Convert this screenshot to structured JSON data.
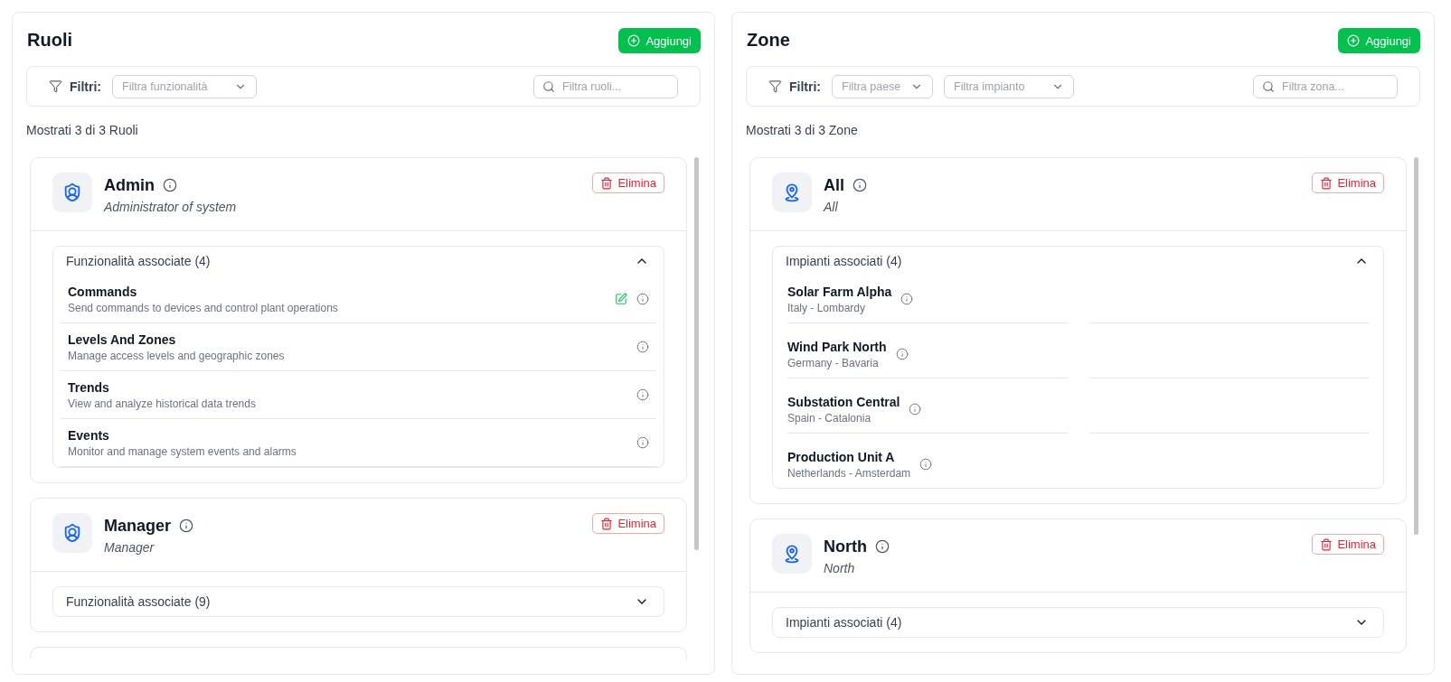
{
  "panels": [
    {
      "title": "Ruoli",
      "add_button": "Aggiungi",
      "filters": {
        "label": "Filtri:",
        "selects": [
          {
            "placeholder": "Filtra funzionalità"
          }
        ],
        "search": {
          "placeholder": "Filtra ruoli..."
        }
      },
      "summary": "Mostrati 3 di 3 Ruoli",
      "cards": [
        {
          "kind": "role",
          "name": "Admin",
          "description": "Administrator of system",
          "delete_button": "Elimina",
          "section": {
            "title": "Funzionalità associate (4)",
            "expanded": true,
            "kind": "list",
            "items": [
              {
                "title": "Commands",
                "subtitle": "Send commands to devices and control plant operations",
                "editable": true
              },
              {
                "title": "Levels And Zones",
                "subtitle": "Manage access levels and geographic zones",
                "editable": false
              },
              {
                "title": "Trends",
                "subtitle": "View and analyze historical data trends",
                "editable": false
              },
              {
                "title": "Events",
                "subtitle": "Monitor and manage system events and alarms",
                "editable": false
              }
            ]
          }
        },
        {
          "kind": "role",
          "name": "Manager",
          "description": "Manager",
          "delete_button": "Elimina",
          "section": {
            "title": "Funzionalità associate (9)",
            "expanded": false
          }
        },
        {
          "kind": "role"
        }
      ]
    },
    {
      "title": "Zone",
      "add_button": "Aggiungi",
      "filters": {
        "label": "Filtri:",
        "selects": [
          {
            "placeholder": "Filtra paese"
          },
          {
            "placeholder": "Filtra impianto"
          }
        ],
        "search": {
          "placeholder": "Filtra zona..."
        }
      },
      "summary": "Mostrati 3 di 3 Zone",
      "cards": [
        {
          "kind": "zone",
          "name": "All",
          "description": "All",
          "delete_button": "Elimina",
          "section": {
            "title": "Impianti associati (4)",
            "expanded": true,
            "kind": "grid",
            "items": [
              {
                "title": "Solar Farm Alpha",
                "subtitle": "Italy - Lombardy"
              },
              {
                "title": "Wind Park North",
                "subtitle": "Germany - Bavaria"
              },
              {
                "title": "Substation Central",
                "subtitle": "Spain - Catalonia"
              },
              {
                "title": "Production Unit A",
                "subtitle": "Netherlands - Amsterdam"
              }
            ]
          }
        },
        {
          "kind": "zone",
          "name": "North",
          "description": "North",
          "delete_button": "Elimina",
          "section": {
            "title": "Impianti associati (4)",
            "expanded": false
          }
        }
      ]
    }
  ]
}
